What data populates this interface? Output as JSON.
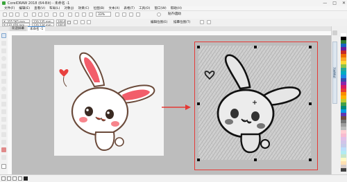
{
  "app": {
    "title": "CorelDRAW 2018 (64-Bit) - 未命名 -1",
    "window_controls": [
      "—",
      "□",
      "✕"
    ]
  },
  "menu": [
    "文件(F)",
    "编辑(E)",
    "查看(V)",
    "布局(L)",
    "对象(J)",
    "效果(C)",
    "位图(B)",
    "文本(X)",
    "表格(T)",
    "工具(O)",
    "窗口(W)",
    "帮助(H)"
  ],
  "toolbar": {
    "zoom_value": "33%",
    "snap_label": "贴齐(T)",
    "launch_label": "启动"
  },
  "propbar": {
    "x_value": "X: 325.565 mm",
    "y_value": "Y: 132.476 mm",
    "w_value": "120.135 mm",
    "h_value": "120.134 mm",
    "scale_x": "100.0",
    "scale_y": "100.0",
    "edit_bitmap_label": "编辑位图(E)",
    "trace_label": "描摹位图(T)"
  },
  "doc_tabs": [
    "欢迎屏幕",
    "未命名 -1"
  ],
  "right_panel": {
    "tab_label": "对象属性"
  },
  "colors": {
    "selection_red": "#e53935",
    "heart": "#e8413f",
    "ear_inner": "#f25d6a",
    "cheek": "#f7858c",
    "arrow": "#e53935"
  },
  "palette": [
    "#ffffff",
    "#000000",
    "#2e7d32",
    "#1565c0",
    "#6a1b9a",
    "#c62828",
    "#ef6c00",
    "#f9a825",
    "#fdd835",
    "#8bc34a",
    "#26a69a",
    "#00acc1",
    "#1e88e5",
    "#3949ab",
    "#8e24aa",
    "#d81b60",
    "#e53935",
    "#fb8c00",
    "#ffb300",
    "#c0ca33",
    "#43a047",
    "#00897b",
    "#039be5",
    "#5e35b1",
    "#6d4c41",
    "#757575",
    "#9e9e9e",
    "#bdbdbd",
    "#ffcdd2",
    "#f8bbd0",
    "#e1bee7",
    "#d1c4e9",
    "#c5cae9",
    "#bbdefb",
    "#b2ebf2",
    "#c8e6c9",
    "#fff9c4",
    "#ffe0b2",
    "#d7ccc8",
    "#424242"
  ],
  "tools": [
    "pick-tool",
    "shape-tool",
    "crop-tool",
    "zoom-tool",
    "freehand-tool",
    "artistic-media-tool",
    "rectangle-tool",
    "ellipse-tool",
    "polygon-tool",
    "text-tool",
    "parallel-dimension-tool",
    "connector-tool",
    "drop-shadow-tool",
    "transparency-tool",
    "color-eyedropper-tool",
    "interactive-fill-tool",
    "smart-fill-tool"
  ]
}
